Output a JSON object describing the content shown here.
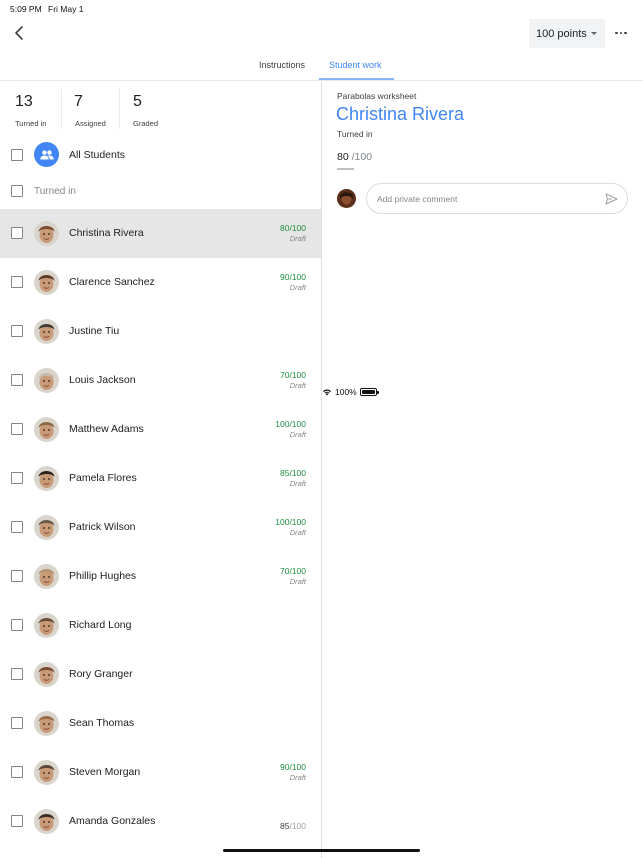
{
  "status_bar": {
    "time": "5:09 PM",
    "date": "Fri May 1",
    "battery": "100%",
    "wifi_icon": "wifi-icon",
    "battery_icon": "battery-icon"
  },
  "topbar": {
    "back_icon": "chevron-left-icon",
    "points_select": "100 points",
    "more_icon": "more-horizontal-icon"
  },
  "tabs": [
    {
      "label": "Instructions",
      "active": false
    },
    {
      "label": "Student work",
      "active": true
    }
  ],
  "colors": {
    "accent": "#4285f4",
    "grade_draft": "#1e8e3e",
    "selected_row": "#e6e6e6"
  },
  "stats": [
    {
      "value": "13",
      "label": "Turned in"
    },
    {
      "value": "7",
      "label": "Assigned"
    },
    {
      "value": "5",
      "label": "Graded"
    }
  ],
  "all_students": {
    "label": "All Students",
    "icon": "people-icon"
  },
  "section": {
    "label": "Turned in"
  },
  "students": [
    {
      "name": "Christina Rivera",
      "score": "80/100",
      "status": "Draft",
      "selected": true,
      "tone": "#7a4a2c"
    },
    {
      "name": "Clarence Sanchez",
      "score": "90/100",
      "status": "Draft",
      "selected": false,
      "tone": "#5a3b28"
    },
    {
      "name": "Justine Tiu",
      "score": "",
      "status": "",
      "selected": false,
      "tone": "#3e3a34"
    },
    {
      "name": "Louis Jackson",
      "score": "70/100",
      "status": "Draft",
      "selected": false,
      "tone": "#c9b9a8"
    },
    {
      "name": "Matthew Adams",
      "score": "100/100",
      "status": "Draft",
      "selected": false,
      "tone": "#8a6a44"
    },
    {
      "name": "Pamela Flores",
      "score": "85/100",
      "status": "Draft",
      "selected": false,
      "tone": "#2b221c"
    },
    {
      "name": "Patrick Wilson",
      "score": "100/100",
      "status": "Draft",
      "selected": false,
      "tone": "#6b5a4a"
    },
    {
      "name": "Phillip Hughes",
      "score": "70/100",
      "status": "Draft",
      "selected": false,
      "tone": "#b59470"
    },
    {
      "name": "Richard Long",
      "score": "",
      "status": "",
      "selected": false,
      "tone": "#6a4e3a"
    },
    {
      "name": "Rory Granger",
      "score": "",
      "status": "",
      "selected": false,
      "tone": "#7b4a33"
    },
    {
      "name": "Sean Thomas",
      "score": "",
      "status": "",
      "selected": false,
      "tone": "#9a6b45"
    },
    {
      "name": "Steven Morgan",
      "score": "90/100",
      "status": "Draft",
      "selected": false,
      "tone": "#5e4535"
    },
    {
      "name": "Amanda Gonzales",
      "score_returned": {
        "num": "85",
        "den": "/100"
      },
      "selected": false,
      "tone": "#3b2a22"
    }
  ],
  "detail": {
    "assignment_title": "Parabolas worksheet",
    "student_name": "Christina Rivera",
    "status": "Turned in",
    "score_value": "80",
    "score_denominator": "/100",
    "comment_placeholder": "Add private comment",
    "send_icon": "send-icon"
  }
}
